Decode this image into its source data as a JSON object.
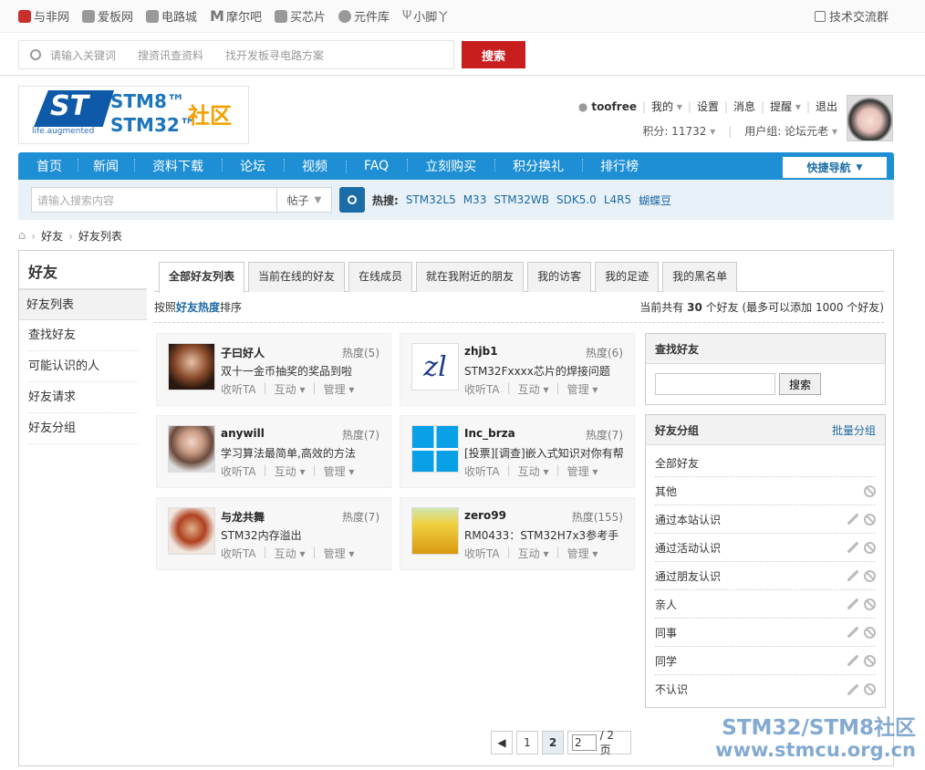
{
  "topbar": {
    "sites": [
      "与非网",
      "爱板网",
      "电路城",
      "摩尔吧",
      "买芯片",
      "元件库",
      "小脚丫"
    ],
    "right": "技术交流群"
  },
  "search": {
    "placeholder": "请输入关键词",
    "hint1": "搜资讯查资料",
    "hint2": "找开发板寻电路方案",
    "button": "搜索"
  },
  "logo": {
    "life": "life.augmented",
    "stm8": "STM8™",
    "stm32": "STM32™",
    "community": "社区"
  },
  "user": {
    "name": "toofree",
    "my": "我的",
    "settings": "设置",
    "messages": "消息",
    "remind": "提醒",
    "logout": "退出",
    "points": "积分: 11732",
    "group": "用户组: 论坛元老"
  },
  "nav": {
    "items": [
      "首页",
      "新闻",
      "资料下载",
      "论坛",
      "视频",
      "FAQ",
      "立刻购买",
      "积分换礼",
      "排行榜"
    ],
    "quick": "快捷导航"
  },
  "subsearch": {
    "placeholder": "请输入搜索内容",
    "type": "帖子",
    "hot_label": "热搜:",
    "tags": [
      "STM32L5",
      "M33",
      "STM32WB",
      "SDK5.0",
      "L4R5",
      "蝴蝶豆"
    ]
  },
  "breadcrumb": [
    "好友",
    "好友列表"
  ],
  "sidebar": {
    "title": "好友",
    "items": [
      "好友列表",
      "查找好友",
      "可能认识的人",
      "好友请求",
      "好友分组"
    ]
  },
  "tabs": [
    "全部好友列表",
    "当前在线的好友",
    "在线成员",
    "就在我附近的朋友",
    "我的访客",
    "我的足迹",
    "我的黑名单"
  ],
  "sort": {
    "prefix": "按照",
    "key": "好友热度",
    "suffix": "排序",
    "count_text_a": "当前共有",
    "count": "30",
    "count_text_b": "个好友 (最多可以添加 1000 个好友)"
  },
  "friends": [
    {
      "name": "子曰好人",
      "heat": "热度(5)",
      "msg": "双十一金币抽奖的奖品到啦"
    },
    {
      "name": "zhjb1",
      "heat": "热度(6)",
      "msg": "STM32Fxxxx芯片的焊接问题"
    },
    {
      "name": "anywill",
      "heat": "热度(7)",
      "msg": "学习算法最简单,高效的方法"
    },
    {
      "name": "Inc_brza",
      "heat": "热度(7)",
      "msg": "[投票][调查]嵌入式知识对你有帮"
    },
    {
      "name": "与龙共舞",
      "heat": "热度(7)",
      "msg": "STM32内存溢出"
    },
    {
      "name": "zero99",
      "heat": "热度(155)",
      "msg": "RM0433：STM32H7x3参考手"
    }
  ],
  "ops": {
    "follow": "收听TA",
    "interact": "互动",
    "manage": "管理"
  },
  "findbox": {
    "title": "查找好友",
    "button": "搜索"
  },
  "groups": {
    "title": "好友分组",
    "batch": "批量分组",
    "items": [
      "全部好友",
      "其他",
      "通过本站认识",
      "通过活动认识",
      "通过朋友认识",
      "亲人",
      "同事",
      "同学",
      "不认识"
    ]
  },
  "pager": {
    "p1": "1",
    "p2": "2",
    "input": "2",
    "total": "/ 2 页"
  },
  "watermark": {
    "line1": "STM32/STM8社区",
    "line2": "www.stmcu.org.cn"
  }
}
